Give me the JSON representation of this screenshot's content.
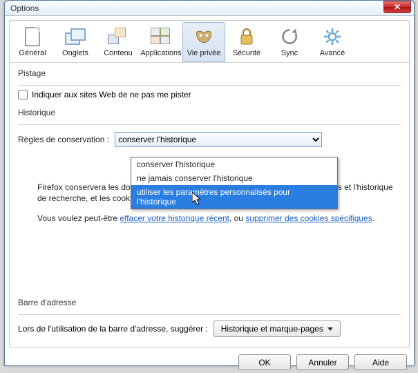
{
  "window": {
    "title": "Options"
  },
  "toolbar_items": [
    {
      "label": "Général"
    },
    {
      "label": "Onglets"
    },
    {
      "label": "Contenu"
    },
    {
      "label": "Applications"
    },
    {
      "label": "Vie privée",
      "selected": true
    },
    {
      "label": "Sécurité"
    },
    {
      "label": "Sync"
    },
    {
      "label": "Avancé"
    }
  ],
  "tracking": {
    "heading": "Pistage",
    "checkbox_label": "Indiquer aux sites Web de ne pas me pister"
  },
  "history": {
    "heading": "Historique",
    "rules_label": "Règles de conservation :",
    "selected": "conserver l'historique",
    "options": [
      "conserver l'historique",
      "ne jamais conserver l'historique",
      "utiliser les paramètres personnalisés pour l'historique"
    ],
    "desc": "Firefox conservera les données de navigation, les téléchargements, les formulaires et l'historique de recherche, et les cookies des sites visités.",
    "links_pre": "Vous voulez peut-être ",
    "link1": "effacer votre historique récent",
    "links_mid": ", ou ",
    "link2": "supprimer des cookies spécifiques",
    "links_post": "."
  },
  "addressbar": {
    "heading": "Barre d'adresse",
    "label": "Lors de l'utilisation de la barre d'adresse, suggérer :",
    "value": "Historique et marque-pages"
  },
  "buttons": {
    "ok": "OK",
    "cancel": "Annuler",
    "help": "Aide"
  }
}
